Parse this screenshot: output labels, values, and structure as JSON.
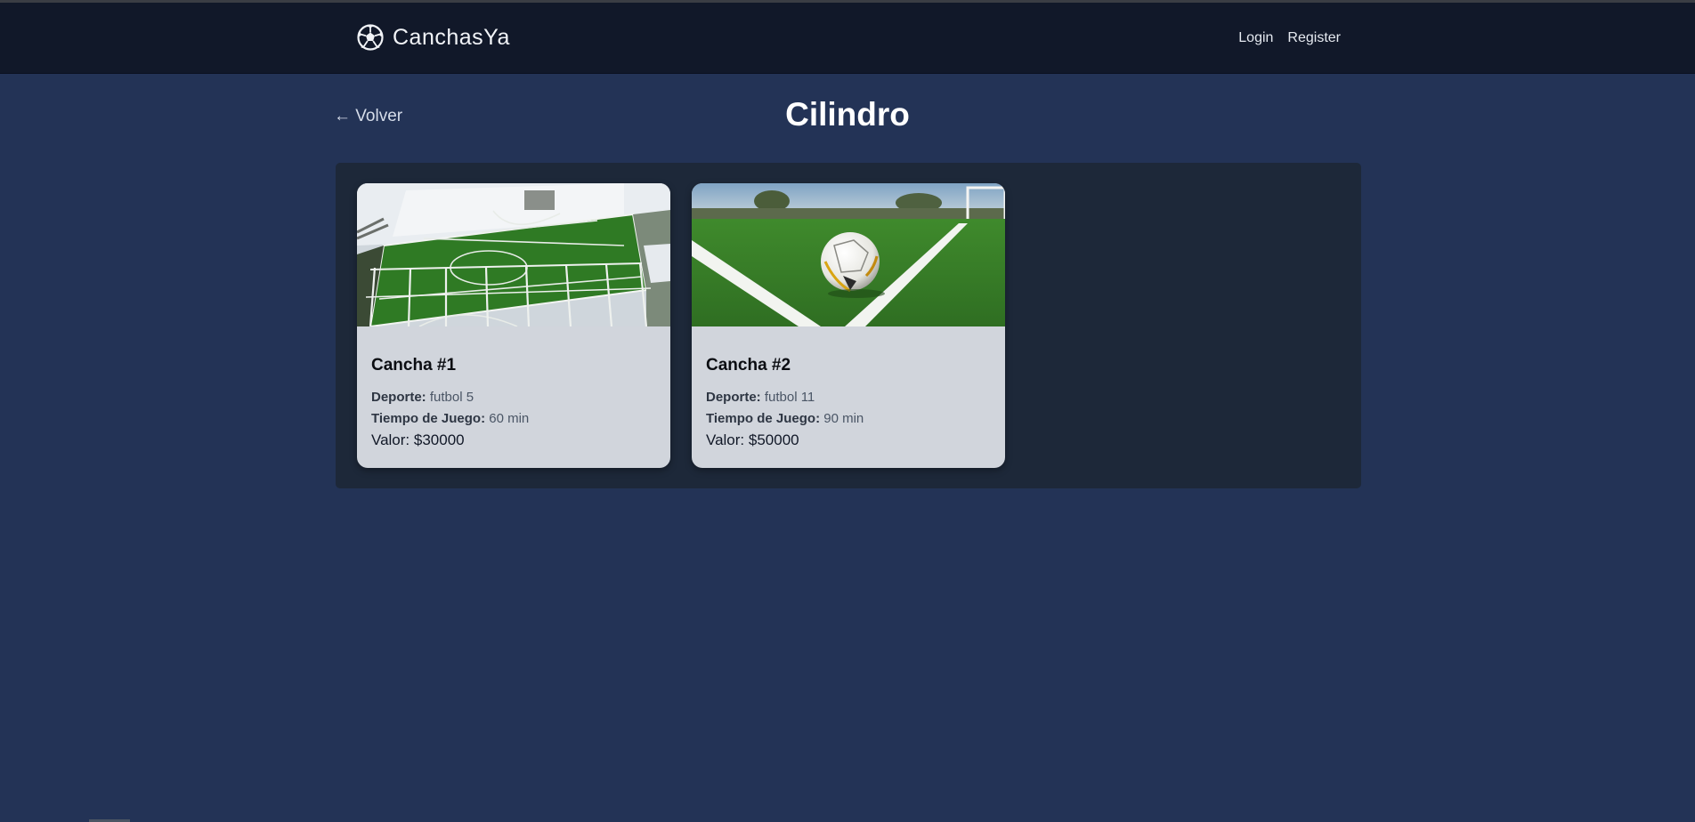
{
  "app": {
    "brand_name": "CanchasYa"
  },
  "nav": {
    "login_label": "Login",
    "register_label": "Register"
  },
  "page": {
    "back_label": "← Volver",
    "title": "Cilindro"
  },
  "courts": [
    {
      "name": "Cancha #1",
      "sport_label": "Deporte:",
      "sport": "futbol 5",
      "time_label": "Tiempo de Juego:",
      "time": "60 min",
      "price": "Valor: $30000"
    },
    {
      "name": "Cancha #2",
      "sport_label": "Deporte:",
      "sport": "futbol 11",
      "time_label": "Tiempo de Juego:",
      "time": "90 min",
      "price": "Valor: $50000"
    }
  ],
  "icons": {
    "brand": "soccer-ball-icon"
  },
  "colors": {
    "page_bg": "#233356",
    "navbar_bg": "#111829",
    "panel_bg": "#1d2839",
    "card_bg": "#d1d5dc"
  }
}
